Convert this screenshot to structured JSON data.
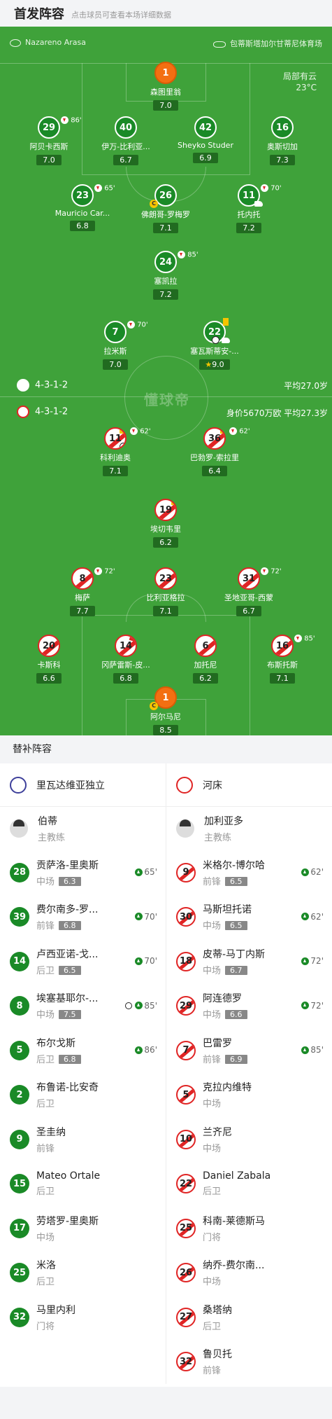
{
  "header": {
    "title": "首发阵容",
    "subtitle": "点击球员可查看本场详细数据"
  },
  "match": {
    "referee": "Nazareno Arasa",
    "stadium": "包蒂斯塔加尔甘蒂尼体育场",
    "weather": "局部有云",
    "temperature": "23°C",
    "watermark": "懂球帝"
  },
  "home": {
    "formation": "4-3-1-2",
    "avg_age": "平均27.0岁"
  },
  "away": {
    "formation": "4-3-1-2",
    "info": "身价5670万欧 平均27.3岁"
  },
  "pitch_players": [
    {
      "num": "1",
      "name": "森图里翁",
      "rating": "7.0"
    },
    {
      "num": "29",
      "name": "阿贝卡西斯",
      "rating": "7.0",
      "sub": "86'"
    },
    {
      "num": "40",
      "name": "伊万-比利亚...",
      "rating": "6.7"
    },
    {
      "num": "42",
      "name": "Sheyko Studer",
      "rating": "6.9"
    },
    {
      "num": "16",
      "name": "奥斯切加",
      "rating": "7.3"
    },
    {
      "num": "23",
      "name": "Mauricio Car...",
      "rating": "6.8",
      "sub": "65'"
    },
    {
      "num": "26",
      "name": "佛朗哥-罗梅罗",
      "rating": "7.1",
      "captain": "C"
    },
    {
      "num": "11",
      "name": "托内托",
      "rating": "7.2",
      "sub": "70'"
    },
    {
      "num": "24",
      "name": "塞凯拉",
      "rating": "7.2",
      "sub": "85'"
    },
    {
      "num": "7",
      "name": "拉米斯",
      "rating": "7.0",
      "sub": "70'"
    },
    {
      "num": "22",
      "name": "塞瓦斯蒂安-...",
      "rating": "9.0"
    },
    {
      "num": "11",
      "name": "科利迪奥",
      "rating": "7.1",
      "sub": "62'"
    },
    {
      "num": "36",
      "name": "巴勃罗-索拉里",
      "rating": "6.4",
      "sub": "62'"
    },
    {
      "num": "19",
      "name": "埃切韦里",
      "rating": "6.2"
    },
    {
      "num": "8",
      "name": "梅萨",
      "rating": "7.7",
      "sub": "72'"
    },
    {
      "num": "23",
      "name": "比利亚格拉",
      "rating": "7.1"
    },
    {
      "num": "31",
      "name": "圣地亚哥-西蒙",
      "rating": "6.7",
      "sub": "72'"
    },
    {
      "num": "20",
      "name": "卡斯科",
      "rating": "6.6"
    },
    {
      "num": "14",
      "name": "冈萨雷斯-皮...",
      "rating": "6.8"
    },
    {
      "num": "6",
      "name": "加托尼",
      "rating": "6.2"
    },
    {
      "num": "16",
      "name": "布斯托斯",
      "rating": "7.1",
      "sub": "85'"
    },
    {
      "num": "1",
      "name": "阿尔马尼",
      "rating": "8.5",
      "captain": "C"
    }
  ],
  "bench": {
    "title": "替补阵容",
    "home": {
      "team": "里瓦达维亚独立",
      "coach": {
        "name": "伯蒂",
        "role": "主教练"
      },
      "players": [
        {
          "num": "28",
          "name": "贡萨洛-里奥斯",
          "pos": "中场",
          "rating": "6.3",
          "in": "65'"
        },
        {
          "num": "39",
          "name": "费尔南多-罗...",
          "pos": "前锋",
          "rating": "6.8",
          "in": "70'"
        },
        {
          "num": "14",
          "name": "卢西亚诺-戈...",
          "pos": "后卫",
          "rating": "6.5",
          "in": "70'"
        },
        {
          "num": "8",
          "name": "埃塞基耶尔-...",
          "pos": "中场",
          "rating": "7.5",
          "in": "85'"
        },
        {
          "num": "5",
          "name": "布尔戈斯",
          "pos": "后卫",
          "rating": "6.8",
          "in": "86'"
        },
        {
          "num": "2",
          "name": "布鲁诺-比安奇",
          "pos": "后卫"
        },
        {
          "num": "9",
          "name": "圣圭纳",
          "pos": "前锋"
        },
        {
          "num": "15",
          "name": "Mateo Ortale",
          "pos": "后卫"
        },
        {
          "num": "17",
          "name": "劳塔罗-里奥斯",
          "pos": "中场"
        },
        {
          "num": "25",
          "name": "米洛",
          "pos": "后卫"
        },
        {
          "num": "32",
          "name": "马里内利",
          "pos": "门将"
        }
      ]
    },
    "away": {
      "team": "河床",
      "coach": {
        "name": "加利亚多",
        "role": "主教练"
      },
      "players": [
        {
          "num": "9",
          "name": "米格尔-博尔哈",
          "pos": "前锋",
          "rating": "6.5",
          "in": "62'"
        },
        {
          "num": "30",
          "name": "马斯坦托诺",
          "pos": "中场",
          "rating": "6.5",
          "in": "62'"
        },
        {
          "num": "18",
          "name": "皮蒂-马丁内斯",
          "pos": "中场",
          "rating": "6.7",
          "in": "72'"
        },
        {
          "num": "29",
          "name": "阿连德罗",
          "pos": "中场",
          "rating": "6.6",
          "in": "72'"
        },
        {
          "num": "7",
          "name": "巴雷罗",
          "pos": "前锋",
          "rating": "6.9",
          "in": "85'"
        },
        {
          "num": "5",
          "name": "克拉内维特",
          "pos": "中场"
        },
        {
          "num": "10",
          "name": "兰齐尼",
          "pos": "中场"
        },
        {
          "num": "22",
          "name": "Daniel Zabala",
          "pos": "后卫"
        },
        {
          "num": "25",
          "name": "科南-莱德斯马",
          "pos": "门将"
        },
        {
          "num": "26",
          "name": "纳乔-费尔南...",
          "pos": "中场"
        },
        {
          "num": "27",
          "name": "桑塔纳",
          "pos": "后卫"
        },
        {
          "num": "32",
          "name": "鲁贝托",
          "pos": "前锋"
        }
      ]
    }
  }
}
